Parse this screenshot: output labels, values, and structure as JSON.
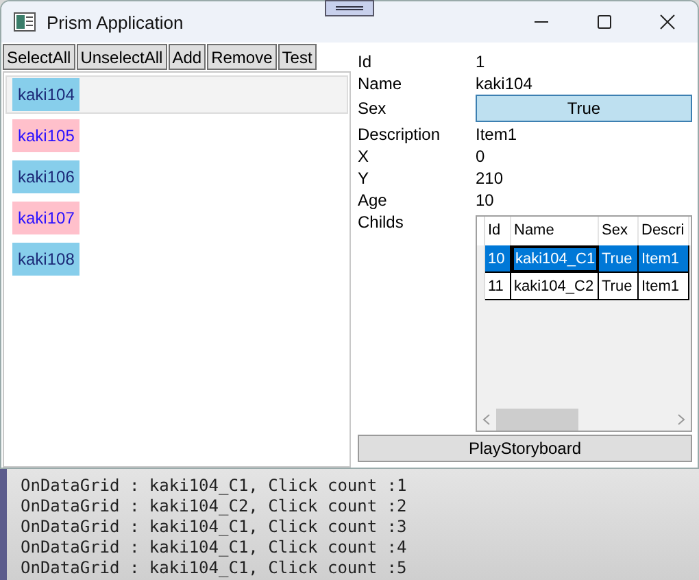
{
  "window": {
    "title": "Prism Application"
  },
  "toolbar": {
    "buttons": [
      "SelectAll",
      "UnselectAll",
      "Add",
      "Remove",
      "Test"
    ]
  },
  "people_list": {
    "items": [
      {
        "label": "kaki104",
        "color": "#87ceeb",
        "selected": true
      },
      {
        "label": "kaki105",
        "color": "#ffc0cb",
        "selected": false
      },
      {
        "label": "kaki106",
        "color": "#87ceeb",
        "selected": false
      },
      {
        "label": "kaki107",
        "color": "#ffc0cb",
        "selected": false
      },
      {
        "label": "kaki108",
        "color": "#87ceeb",
        "selected": false
      }
    ]
  },
  "details": {
    "fields": [
      {
        "kind": "text",
        "label": "Id",
        "value": "1"
      },
      {
        "kind": "text",
        "label": "Name",
        "value": "kaki104"
      },
      {
        "kind": "toggle",
        "label": "Sex",
        "value": "True",
        "checked": true
      },
      {
        "kind": "text",
        "label": "Description",
        "value": "Item1"
      },
      {
        "kind": "text",
        "label": "X",
        "value": "0"
      },
      {
        "kind": "text",
        "label": "Y",
        "value": "210"
      },
      {
        "kind": "text",
        "label": "Age",
        "value": "10"
      },
      {
        "kind": "grid",
        "label": "Childs"
      }
    ]
  },
  "childs_grid": {
    "columns": [
      "Id",
      "Name",
      "Sex",
      "Descri"
    ],
    "rows": [
      {
        "cells": [
          "10",
          "kaki104_C1",
          "True",
          "Item1"
        ],
        "focused": [
          false,
          true,
          false,
          false
        ],
        "selected": true
      },
      {
        "cells": [
          "11",
          "kaki104_C2",
          "True",
          "Item1"
        ],
        "focused": [
          false,
          false,
          false,
          false
        ],
        "selected": false
      }
    ]
  },
  "play_button": {
    "label": "PlayStoryboard"
  },
  "output": {
    "lines": [
      "OnDataGrid : kaki104_C1, Click count :1",
      "OnDataGrid : kaki104_C2, Click count :2",
      "OnDataGrid : kaki104_C1, Click count :3",
      "OnDataGrid : kaki104_C1, Click count :4",
      "OnDataGrid : kaki104_C1, Click count :5"
    ]
  }
}
